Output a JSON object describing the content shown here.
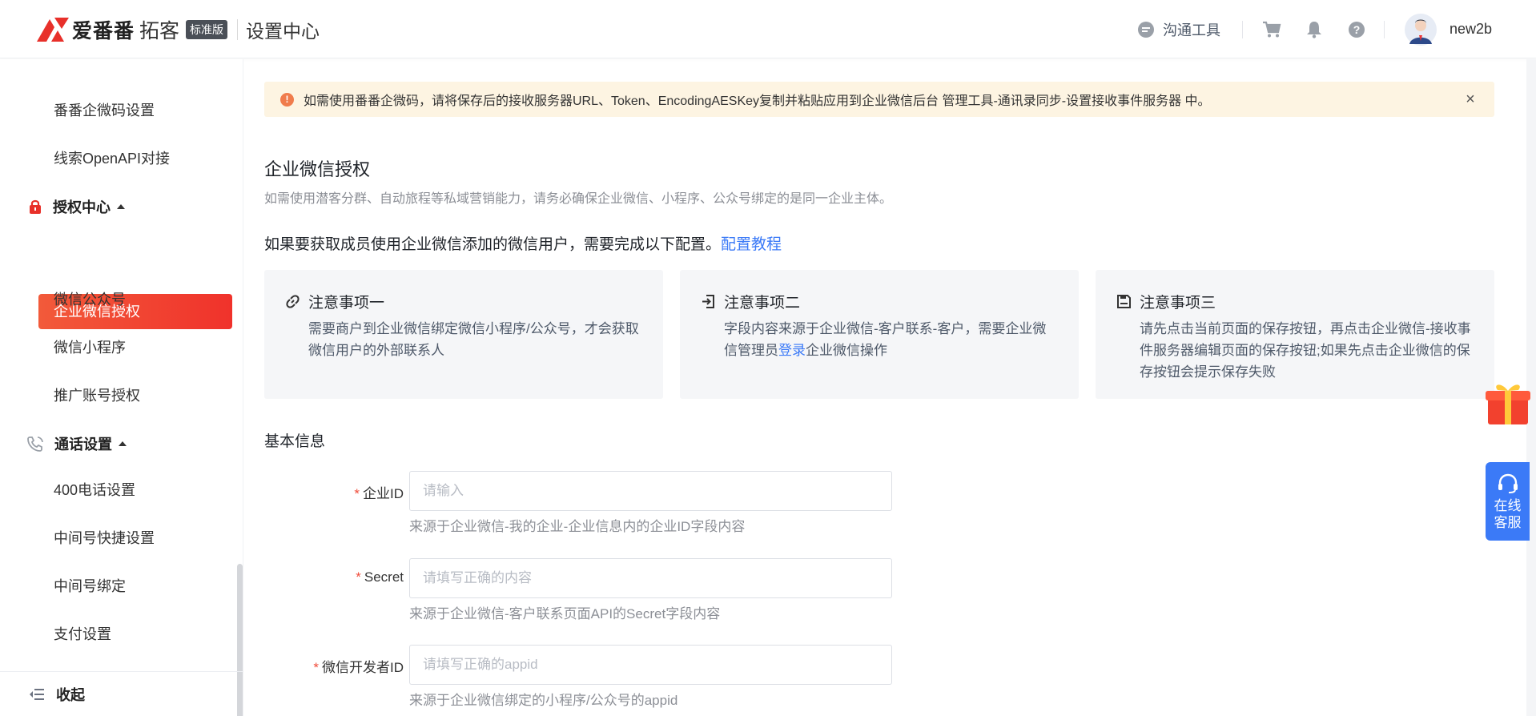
{
  "header": {
    "brand": "爱番番",
    "product": "拓客",
    "edition_badge": "标准版",
    "page_title": "设置中心",
    "chat_tool_label": "沟通工具",
    "username": "new2b",
    "icons": [
      "chat-icon",
      "cart-icon",
      "bell-icon",
      "help-icon",
      "avatar"
    ]
  },
  "sidebar": {
    "items_top": [
      {
        "label": "番番企微码设置"
      },
      {
        "label": "线索OpenAPI对接"
      }
    ],
    "group_auth": {
      "label": "授权中心",
      "icon": "lock-icon"
    },
    "auth_items": [
      {
        "label": "企业微信授权",
        "active": true
      },
      {
        "label": "微信公众号"
      },
      {
        "label": "微信小程序"
      },
      {
        "label": "推广账号授权"
      }
    ],
    "group_call": {
      "label": "通话设置",
      "icon": "phone-icon"
    },
    "call_items": [
      {
        "label": "400电话设置"
      },
      {
        "label": "中间号快捷设置"
      },
      {
        "label": "中间号绑定"
      },
      {
        "label": "支付设置"
      }
    ],
    "collapse_label": "收起"
  },
  "alert": {
    "text": "如需使用番番企微码，请将保存后的接收服务器URL、Token、EncodingAESKey复制并粘贴应用到企业微信后台 管理工具-通讯录同步-设置接收事件服务器 中。"
  },
  "section": {
    "title": "企业微信授权",
    "description": "如需使用潜客分群、自动旅程等私域营销能力，请务必确保企业微信、小程序、公众号绑定的是同一企业主体。",
    "config_text": "如果要获取成员使用企业微信添加的微信用户，需要完成以下配置。",
    "config_link": "配置教程"
  },
  "cards": [
    {
      "title": "注意事项一",
      "icon": "link-icon",
      "body": "需要商户到企业微信绑定微信小程序/公众号，才会获取微信用户的外部联系人"
    },
    {
      "title": "注意事项二",
      "icon": "login-icon",
      "body_before": "字段内容来源于企业微信-客户联系-客户，需要企业微信管理员",
      "body_link": "登录",
      "body_after": "企业微信操作"
    },
    {
      "title": "注意事项三",
      "icon": "save-icon",
      "body": "请先点击当前页面的保存按钮，再点击企业微信-接收事件服务器编辑页面的保存按钮;如果先点击企业微信的保存按钮会提示保存失败"
    }
  ],
  "form": {
    "section_title": "基本信息",
    "required_mark": "*",
    "fields": [
      {
        "label": "企业ID",
        "placeholder": "请输入",
        "value": "",
        "help": "来源于企业微信-我的企业-企业信息内的企业ID字段内容"
      },
      {
        "label": "Secret",
        "placeholder": "请填写正确的内容",
        "value": "",
        "help": "来源于企业微信-客户联系页面API的Secret字段内容"
      },
      {
        "label": "微信开发者ID",
        "placeholder": "请填写正确的appid",
        "value": "",
        "help": "来源于企业微信绑定的小程序/公众号的appid"
      }
    ]
  },
  "floating": {
    "support_label": "在线客服",
    "icons": [
      "gift-icon",
      "headset-icon"
    ]
  },
  "colors": {
    "accent": "#f0322b",
    "link": "#3b7af7",
    "alert_bg": "#fdf4e2",
    "card_bg": "#f5f6f8"
  }
}
